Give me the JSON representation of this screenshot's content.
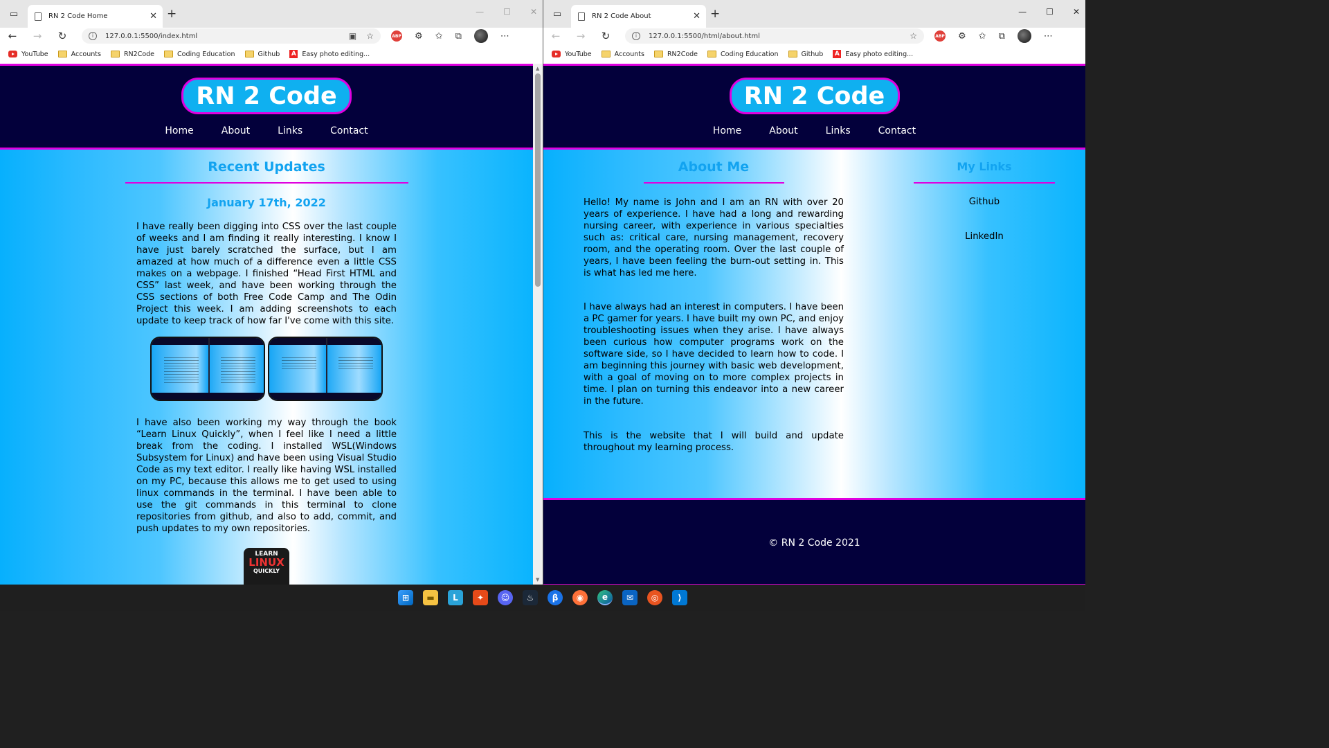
{
  "bookmarks": [
    "YouTube",
    "Accounts",
    "RN2Code",
    "Coding Education",
    "Github",
    "Easy photo editing..."
  ],
  "left_window": {
    "tab_title": "RN 2 Code Home",
    "url": "127.0.0.1:5500/index.html"
  },
  "right_window": {
    "tab_title": "RN 2 Code About",
    "url": "127.0.0.1:5500/html/about.html"
  },
  "site": {
    "logo": "RN 2 Code",
    "nav": [
      "Home",
      "About",
      "Links",
      "Contact"
    ],
    "footer": "© RN 2 Code 2021"
  },
  "home": {
    "title": "Recent Updates",
    "date": "January 17th, 2022",
    "para1": "I have really been digging into CSS over the last couple of weeks and I am finding it really interesting. I know I have just barely scratched the surface, but I am amazed at how much of a difference even a little CSS makes on a webpage. I finished “Head First HTML and CSS” last week, and have been working through the CSS sections of both Free Code Camp and The Odin Project this week. I am adding screenshots to each update to keep track of how far I've come with this site.",
    "para2": "I have also been working my way through the book “Learn Linux Quickly”, when I feel like I need a little break from the coding. I installed WSL(Windows Subsystem for Linux) and have been using Visual Studio Code as my text editor. I really like having WSL installed on my PC, because this allows me to get used to using linux commands in the terminal. I have been able to use the git commands in this terminal to clone repositories from github, and also to add, commit, and push updates to my own repositories.",
    "book_cover": [
      "LEARN",
      "LINUX",
      "QUICKLY"
    ]
  },
  "about": {
    "title": "About Me",
    "links_title": "My Links",
    "links": [
      "Github",
      "LinkedIn"
    ],
    "para1": "Hello! My name is John and I am an RN with over 20 years of experience. I have had a long and rewarding nursing career, with experience in various specialties such as: critical care, nursing management, recovery room, and the operating room. Over the last couple of years, I have been feeling the burn-out setting in. This is what has led me here.",
    "para2": "I have always had an interest in computers. I have been a PC gamer for years. I have built my own PC, and enjoy troubleshooting issues when they arise. I have always been curious how computer programs work on the software side, so I have decided to learn how to code. I am beginning this journey with basic web development, with a goal of moving on to more complex projects in time. I plan on turning this endeavor into a new career in the future.",
    "para3": "This is the website that I will build and update throughout my learning process."
  },
  "colors": {
    "header_bg": "#03003b",
    "accent": "#e000e0",
    "logo_bg": "#0fb0f0",
    "heading": "#12a3f0"
  },
  "taskbar_icons": [
    "start-icon",
    "file-explorer-icon",
    "libby-icon",
    "app-icon",
    "discord-icon",
    "steam-icon",
    "chrome-beta-icon",
    "firefox-icon",
    "edge-icon",
    "mail-icon",
    "ubuntu-icon",
    "vscode-icon"
  ]
}
